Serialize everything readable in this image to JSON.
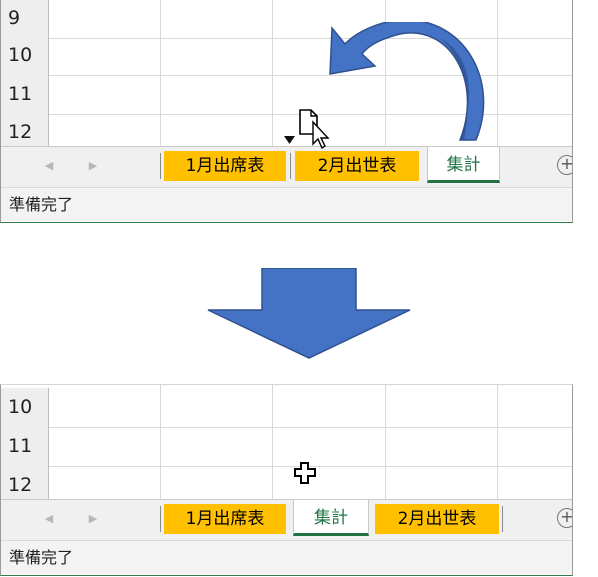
{
  "before": {
    "rows": [
      "9",
      "10",
      "11",
      "12"
    ],
    "tabs": [
      "1月出席表",
      "2月出世表",
      "集計"
    ],
    "status": "準備完了",
    "nav_left": "◀",
    "nav_right": "▶",
    "add_sheet": "+"
  },
  "after": {
    "rows": [
      "10",
      "11",
      "12"
    ],
    "tabs": [
      "1月出席表",
      "集計",
      "2月出世表"
    ],
    "status": "準備完了",
    "nav_left": "◀",
    "nav_right": "▶",
    "add_sheet": "+"
  },
  "colors": {
    "tab_orange": "#ffc000",
    "active_tab_text": "#217346",
    "arrow_blue": "#4472c4",
    "arrow_dark": "#2f528f"
  },
  "icons": [
    "curved-move-arrow-icon",
    "drop-caret-icon",
    "sheet-drag-cursor-icon",
    "down-transition-arrow-icon",
    "move-cross-cursor-icon"
  ]
}
